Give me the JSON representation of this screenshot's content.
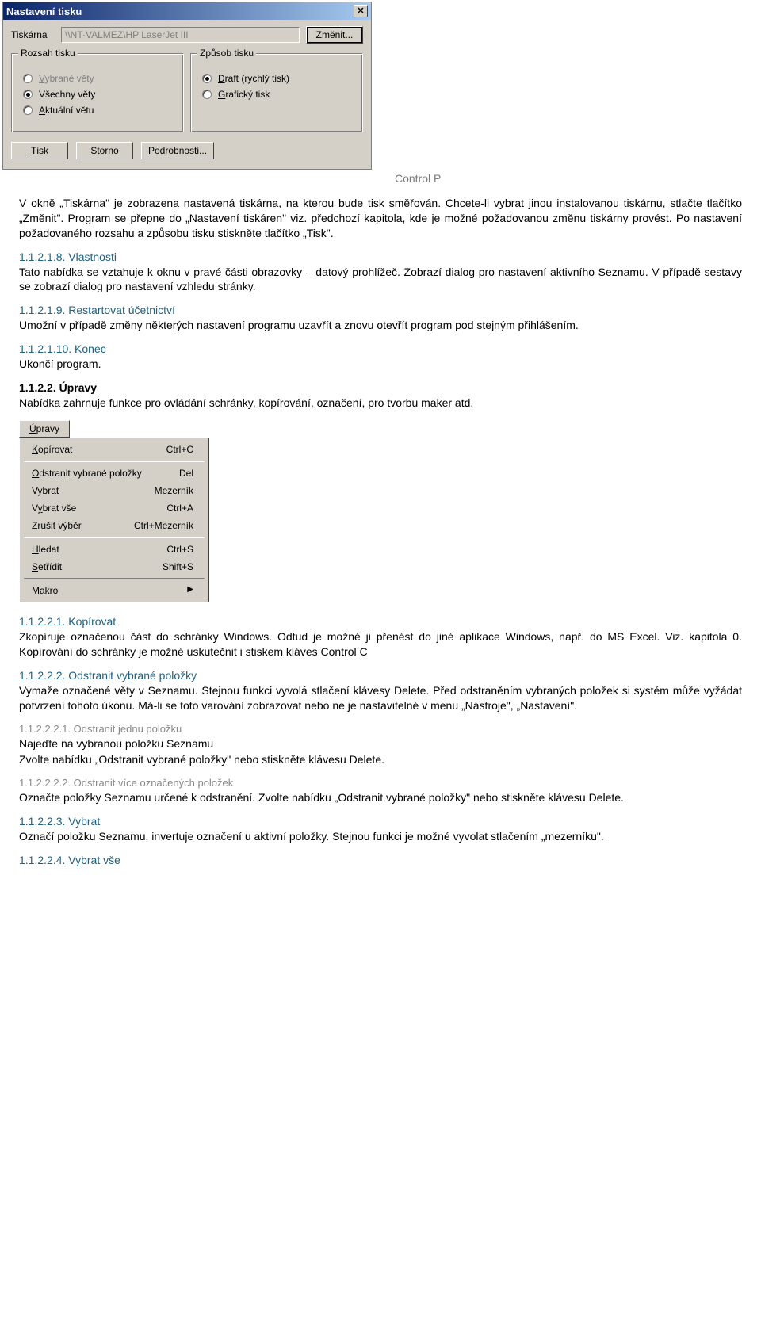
{
  "dialog": {
    "title": "Nastavení tisku",
    "printer_label": "Tiskárna",
    "printer_value": "\\\\NT-VALMEZ\\HP LaserJet III",
    "change_btn": "Změnit...",
    "group_range": {
      "legend": "Rozsah tisku",
      "opt_selected": "Vybrané věty",
      "opt_all": "Všechny věty",
      "opt_current": "Aktuální větu"
    },
    "group_mode": {
      "legend": "Způsob tisku",
      "opt_draft": "Draft (rychlý tisk)",
      "opt_graphic": "Grafický tisk"
    },
    "btn_print": "Tisk",
    "btn_cancel": "Storno",
    "btn_details": "Podrobnosti..."
  },
  "doc": {
    "control_p": "Control P",
    "p_tiskarna": "V okně „Tiskárna\" je zobrazena nastavená tiskárna, na kterou bude tisk směřován. Chcete-li vybrat jinou instalovanou tiskárnu, stlačte tlačítko „Změnit\". Program se přepne do „Nastavení tiskáren\" viz. předchozí kapitola, kde je možné požadovanou změnu tiskárny provést. Po nastavení požadovaného rozsahu a způsobu tisku stiskněte tlačítko „Tisk\".",
    "h_vlastnosti": "1.1.2.1.8. Vlastnosti",
    "p_vlastnosti": "Tato nabídka se vztahuje k oknu v pravé části obrazovky – datový prohlížeč. Zobrazí dialog pro nastavení aktivního Seznamu. V případě sestavy se zobrazí dialog pro nastavení vzhledu stránky.",
    "h_restart": "1.1.2.1.9. Restartovat účetnictví",
    "p_restart": "Umožní v případě změny některých nastavení programu uzavřít a znovu otevřít program pod stejným přihlášením.",
    "h_konec": "1.1.2.1.10. Konec",
    "p_konec": "Ukončí program.",
    "h_upravy": "1.1.2.2. Úpravy",
    "p_upravy": "Nabídka zahrnuje funkce pro ovládání schránky, kopírování, označení, pro tvorbu maker atd.",
    "h_kopirovat": "1.1.2.2.1. Kopírovat",
    "p_kopirovat": "Zkopíruje označenou část do schránky Windows. Odtud je možné ji přenést do jiné aplikace Windows, např. do MS Excel. Viz. kapitola 0. Kopírování do schránky je možné uskutečnit i stiskem kláves Control C",
    "h_odstranit": "1.1.2.2.2. Odstranit vybrané položky",
    "p_odstranit": "Vymaže označené věty v Seznamu. Stejnou funkci vyvolá stlačení klávesy Delete. Před odstraněním vybraných položek si systém může vyžádat potvrzení tohoto úkonu. Má-li se toto varování zobrazovat nebo ne je nastavitelné v menu „Nástroje\", „Nastavení\".",
    "h_odstr1": "1.1.2.2.2.1. Odstranit jednu položku",
    "p_odstr1a": "Najeďte na vybranou položku Seznamu",
    "p_odstr1b": "Zvolte nabídku „Odstranit vybrané položky\" nebo stiskněte klávesu Delete.",
    "h_odstr2": "1.1.2.2.2.2. Odstranit více označených položek",
    "p_odstr2": "Označte položky Seznamu určené k odstranění. Zvolte nabídku „Odstranit vybrané položky\" nebo stiskněte klávesu Delete.",
    "h_vybrat": "1.1.2.2.3. Vybrat",
    "p_vybrat": "Označí položku Seznamu, invertuje označení u aktivní položky. Stejnou funkci je možné vyvolat stlačením „mezerníku\".",
    "h_vybratvse": "1.1.2.2.4. Vybrat vše"
  },
  "menu": {
    "button": "Úpravy",
    "items": [
      {
        "label": "Kopírovat",
        "shortcut": "Ctrl+C"
      },
      {
        "sep": true
      },
      {
        "label": "Odstranit vybrané položky",
        "shortcut": "Del"
      },
      {
        "label": "Vybrat",
        "shortcut": "Mezerník"
      },
      {
        "label": "Vybrat vše",
        "shortcut": "Ctrl+A"
      },
      {
        "label": "Zrušit výběr",
        "shortcut": "Ctrl+Mezerník"
      },
      {
        "sep": true
      },
      {
        "label": "Hledat",
        "shortcut": "Ctrl+S"
      },
      {
        "label": "Setřídit",
        "shortcut": "Shift+S"
      },
      {
        "sep": true
      },
      {
        "label": "Makro",
        "shortcut": "▶"
      }
    ]
  }
}
